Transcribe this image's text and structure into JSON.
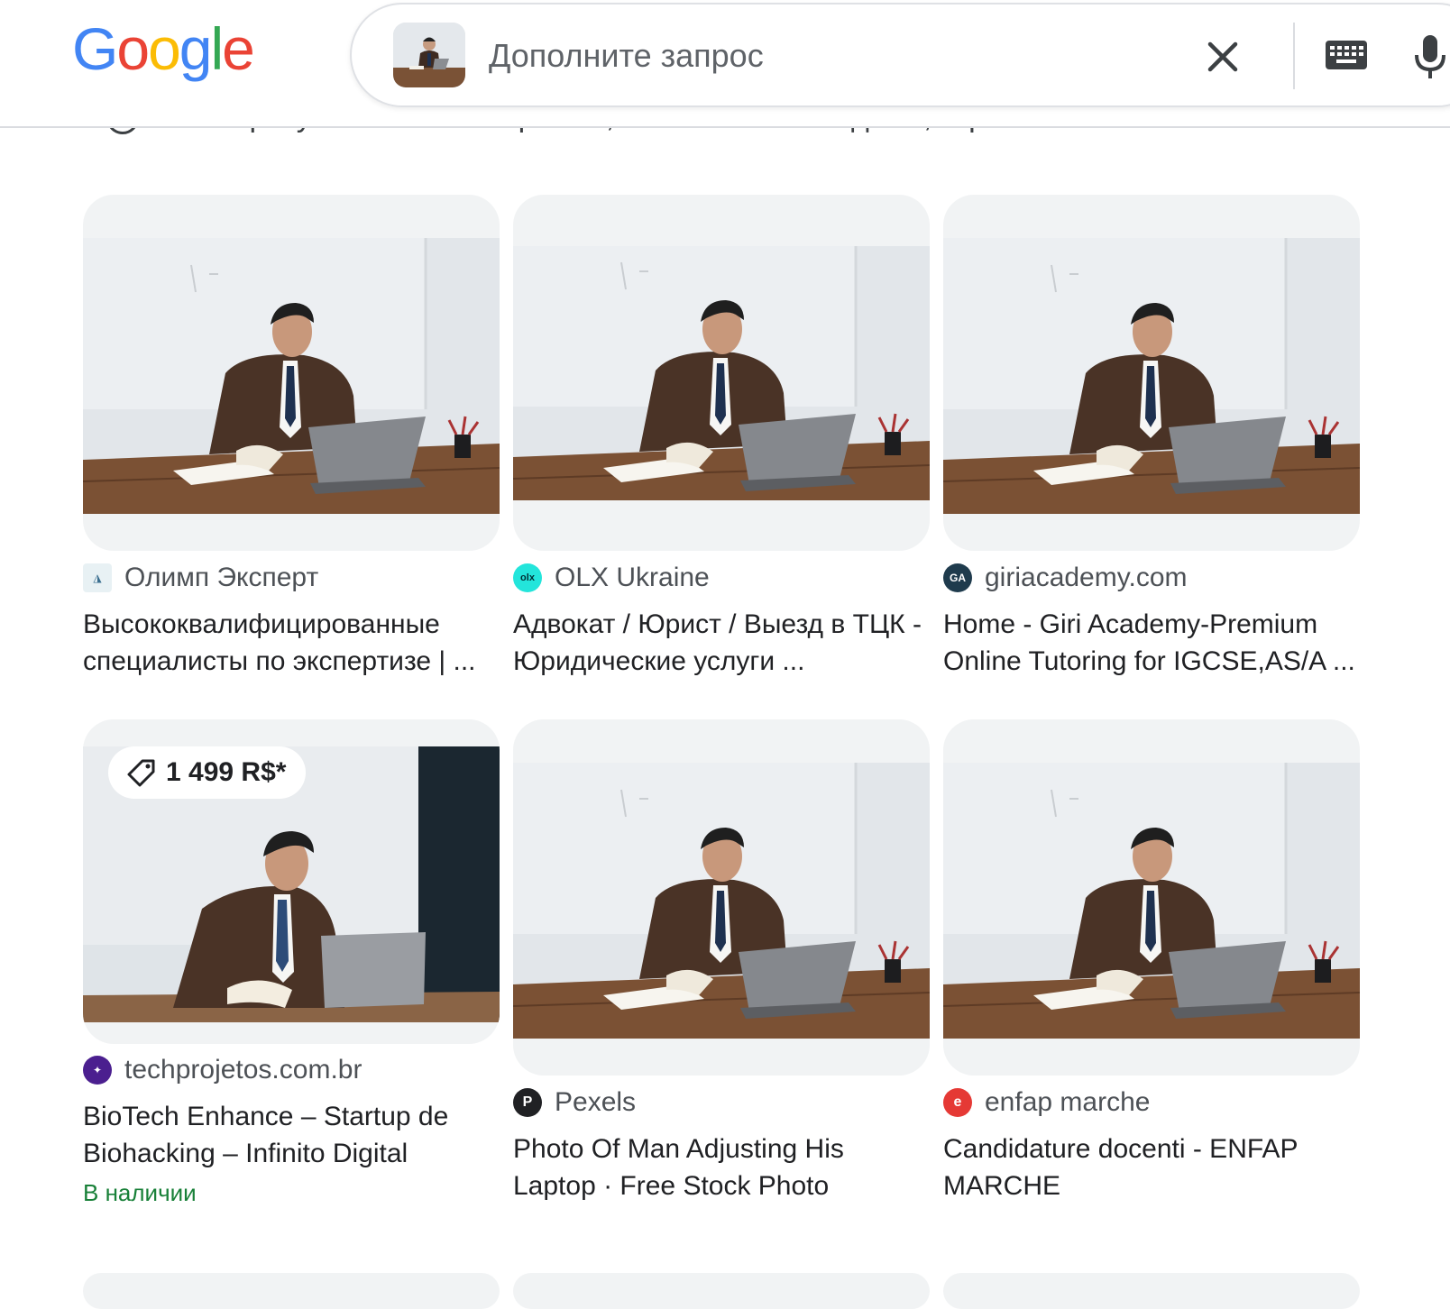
{
  "logo": {
    "letters": [
      "G",
      "o",
      "o",
      "g",
      "l",
      "e"
    ],
    "colors": [
      "#4285F4",
      "#EA4335",
      "#FBBC05",
      "#4285F4",
      "#34A853",
      "#EA4335"
    ]
  },
  "search": {
    "placeholder": "Дополните запрос",
    "icons": {
      "clear": "close-icon",
      "keyboard": "keyboard-icon",
      "voice": "microphone-icon"
    }
  },
  "notice": {
    "text": "Показ результатов по запросам, связанным с людьми, ограничен."
  },
  "results": [
    {
      "source": "Олимп Эксперт",
      "favicon": "olimp-expert-logo",
      "title": "Высококвалифицированные специалисты по экспертизе | ..."
    },
    {
      "source": "OLX Ukraine",
      "favicon": "olx-logo",
      "favicon_color": "#23e5db",
      "title": "Адвокат / Юрист / Выезд в ТЦК - Юридические услуги ..."
    },
    {
      "source": "giriacademy.com",
      "favicon": "giri-academy-logo",
      "favicon_color": "#1f3b4d",
      "title": "Home - Giri Academy-Premium Online Tutoring for IGCSE,AS/A ..."
    },
    {
      "source": "techprojetos.com.br",
      "favicon": "techprojetos-logo",
      "favicon_color": "#4b1f8f",
      "title": "BioTech Enhance – Startup de Biohacking – Infinito Digital",
      "price": "1 499 R$*",
      "stock": "В наличии"
    },
    {
      "source": "Pexels",
      "favicon": "pexels-logo",
      "favicon_color": "#202124",
      "title": "Photo Of Man Adjusting His Laptop · Free Stock Photo"
    },
    {
      "source": "enfap marche",
      "favicon": "enfap-logo",
      "favicon_color": "#e53935",
      "title": "Candidature docenti - ENFAP MARCHE"
    }
  ],
  "colors": {
    "stock_green": "#188038",
    "card_bg": "#f1f3f4",
    "link_text": "#202124"
  }
}
